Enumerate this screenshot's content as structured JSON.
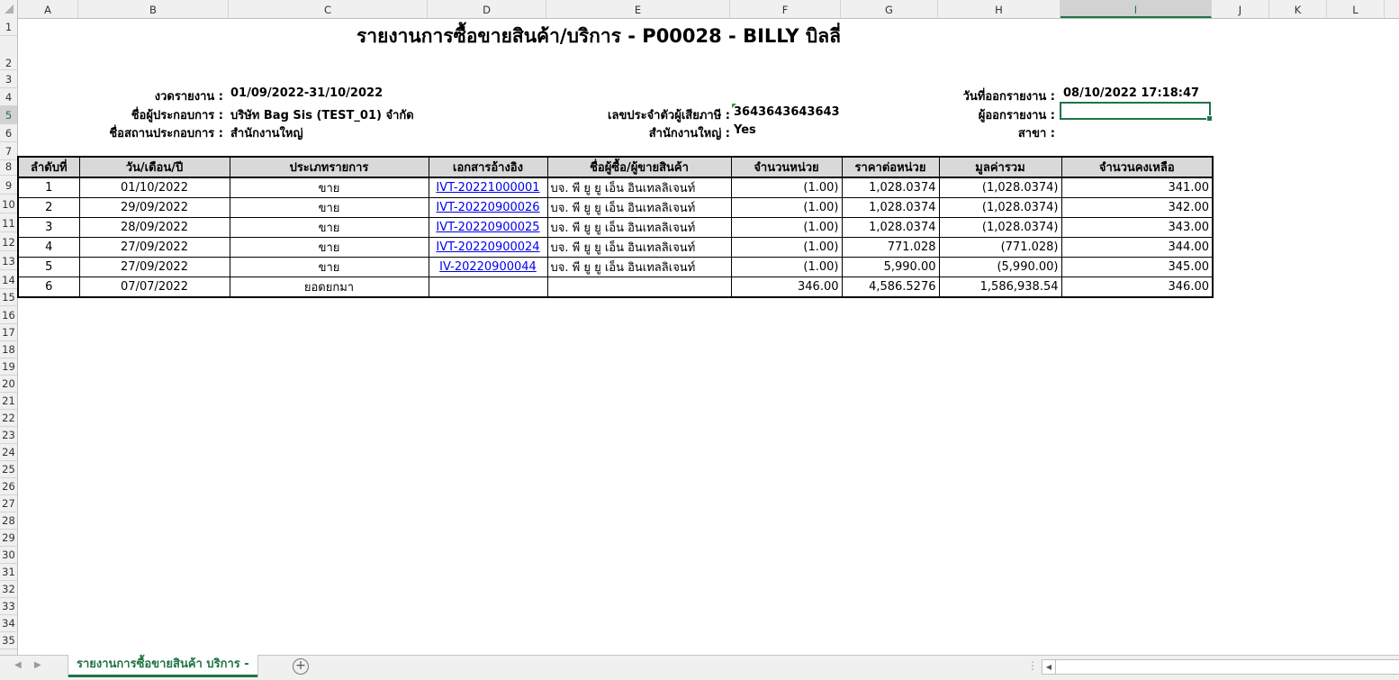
{
  "columns": [
    "A",
    "B",
    "C",
    "D",
    "E",
    "F",
    "G",
    "H",
    "I",
    "J",
    "K",
    "L"
  ],
  "rows": [
    "1",
    "2",
    "3",
    "4",
    "5",
    "6",
    "7",
    "8",
    "9",
    "10",
    "11",
    "12",
    "13",
    "14",
    "15",
    "16",
    "17",
    "18",
    "19",
    "20",
    "21",
    "22",
    "23",
    "24",
    "25",
    "26",
    "27",
    "28",
    "29",
    "30",
    "31",
    "32",
    "33",
    "34",
    "35"
  ],
  "report": {
    "title": "รายงานการซื้อขายสินค้า/บริการ - P00028 - BILLY บิลลี่",
    "period_label": "งวดรายงาน :",
    "period_value": "01/09/2022-31/10/2022",
    "operator_label": "ชื่อผู้ประกอบการ :",
    "operator_value": "บริษัท Bag Sis (TEST_01) จำกัด",
    "branch_name_label": "ชื่อสถานประกอบการ :",
    "branch_name_value": "สำนักงานใหญ่",
    "tax_id_label": "เลขประจำตัวผู้เสียภาษี :",
    "tax_id_value": "3643643643643",
    "head_office_label": "สำนักงานใหญ่ :",
    "head_office_value": "Yes",
    "issue_date_label": "วันที่ออกรายงาน :",
    "issue_date_value": "08/10/2022 17:18:47",
    "issuer_label": "ผู้ออกรายงาน :",
    "branch_label": "สาขา :"
  },
  "table": {
    "headers": [
      "ลำดับที่",
      "วัน/เดือน/ปี",
      "ประเภทรายการ",
      "เอกสารอ้างอิง",
      "ชื่อผู้ซื้อ/ผู้ขายสินค้า",
      "จำนวนหน่วย",
      "ราคาต่อหน่วย",
      "มูลค่ารวม",
      "จำนวนคงเหลือ"
    ],
    "rows": [
      {
        "no": "1",
        "date": "01/10/2022",
        "type": "ขาย",
        "ref": "IVT-20221000001",
        "party": "บจ.  พี ยู ยู เอ็น อินเทลลิเจนท์",
        "qty": "(1.00)",
        "price": "1,028.0374",
        "total": "(1,028.0374)",
        "balance": "341.00"
      },
      {
        "no": "2",
        "date": "29/09/2022",
        "type": "ขาย",
        "ref": "IVT-20220900026",
        "party": "บจ.  พี ยู ยู เอ็น อินเทลลิเจนท์",
        "qty": "(1.00)",
        "price": "1,028.0374",
        "total": "(1,028.0374)",
        "balance": "342.00"
      },
      {
        "no": "3",
        "date": "28/09/2022",
        "type": "ขาย",
        "ref": "IVT-20220900025",
        "party": "บจ.  พี ยู ยู เอ็น อินเทลลิเจนท์",
        "qty": "(1.00)",
        "price": "1,028.0374",
        "total": "(1,028.0374)",
        "balance": "343.00"
      },
      {
        "no": "4",
        "date": "27/09/2022",
        "type": "ขาย",
        "ref": "IVT-20220900024",
        "party": "บจ.  พี ยู ยู เอ็น อินเทลลิเจนท์",
        "qty": "(1.00)",
        "price": "771.028",
        "total": "(771.028)",
        "balance": "344.00"
      },
      {
        "no": "5",
        "date": "27/09/2022",
        "type": "ขาย",
        "ref": "IV-20220900044",
        "party": "บจ.  พี ยู ยู เอ็น อินเทลลิเจนท์",
        "qty": "(1.00)",
        "price": "5,990.00",
        "total": "(5,990.00)",
        "balance": "345.00"
      },
      {
        "no": "6",
        "date": "07/07/2022",
        "type": "ยอดยกมา",
        "ref": "",
        "party": "",
        "qty": "346.00",
        "price": "4,586.5276",
        "total": "1,586,938.54",
        "balance": "346.00"
      }
    ]
  },
  "sheet_tab": "รายงานการซื้อขายสินค้า บริการ -",
  "colors": {
    "accent": "#217346",
    "link": "#0000ee",
    "header_fill": "#d9d9d9"
  }
}
